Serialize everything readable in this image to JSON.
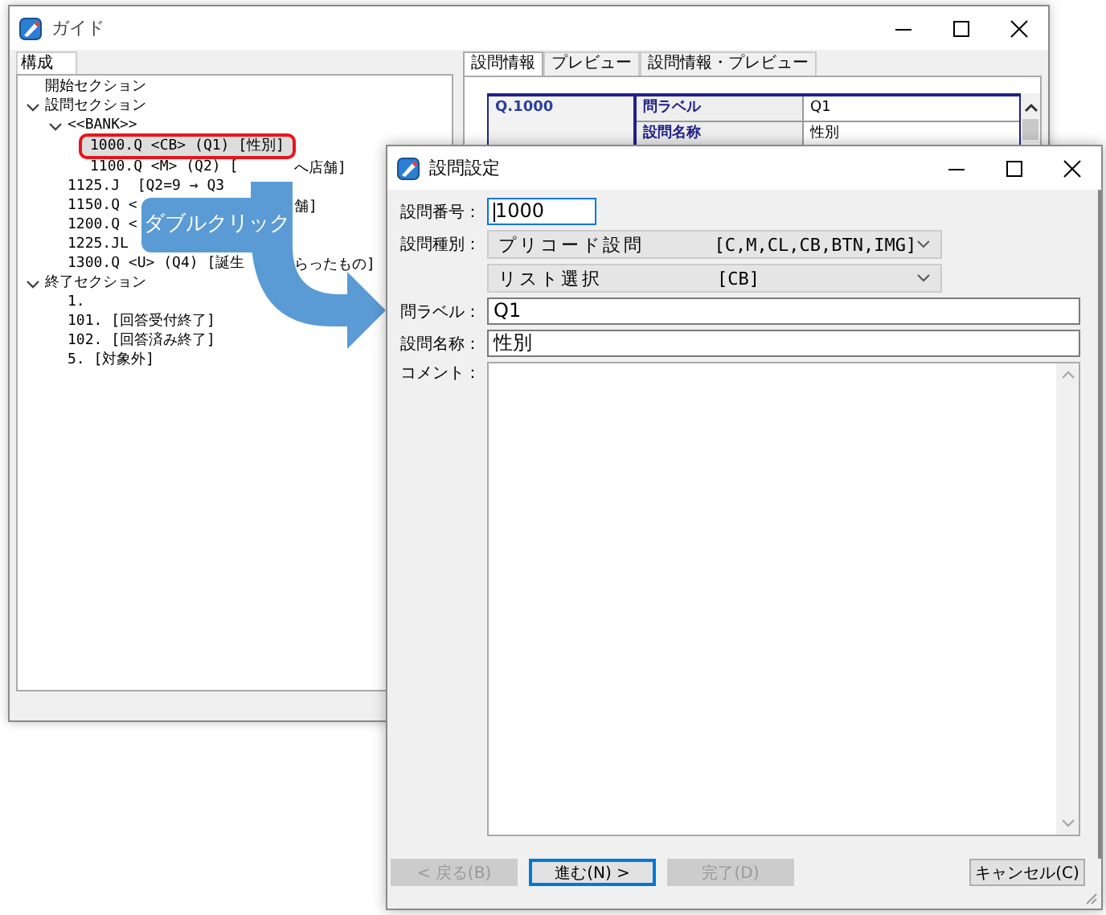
{
  "main_window": {
    "title": "ガイド",
    "left_tab": "構成",
    "tree": [
      {
        "label": "開始セクション",
        "selected": false
      },
      {
        "label": "設問セクション",
        "expanded": true,
        "selected": false,
        "children": [
          {
            "label": "<<BANK>>",
            "expanded": true,
            "selected": false,
            "children": [
              {
                "label": "1000.Q <CB> (Q1) [性別]",
                "selected": true
              },
              {
                "label": "1100.Q <M> (Q2) [",
                "tail": "へ店舗]",
                "selected": false
              }
            ]
          },
          {
            "label": "1125.J  [Q2=9 → Q3",
            "selected": false
          },
          {
            "label": "1150.Q <",
            "tail": "舗]",
            "selected": false
          },
          {
            "label": "1200.Q <",
            "selected": false
          },
          {
            "label": "1225.JL",
            "selected": false
          },
          {
            "label": "1300.Q <U> (Q4) [誕生",
            "tail": "らったもの]",
            "selected": false
          }
        ]
      },
      {
        "label": "終了セクション",
        "expanded": true,
        "selected": false,
        "children": [
          {
            "label": "1.",
            "selected": false
          },
          {
            "label": "101. [回答受付終了]",
            "selected": false
          },
          {
            "label": "102. [回答済み終了]",
            "selected": false
          },
          {
            "label": "5. [対象外]",
            "selected": false
          }
        ]
      }
    ],
    "tabs": [
      {
        "label": "設問情報",
        "selected": true
      },
      {
        "label": "プレビュー",
        "selected": false
      },
      {
        "label": "設問情報・プレビュー",
        "selected": false
      }
    ],
    "info_table": {
      "question": "Q.1000",
      "rows": [
        {
          "label": "問ラベル",
          "value": "Q1"
        },
        {
          "label": "設問名称",
          "value": "性別"
        }
      ]
    }
  },
  "callout": {
    "text": "ダブルクリック"
  },
  "dialog": {
    "title": "設問設定",
    "fields": [
      {
        "kind": "input",
        "label": "設問番号：",
        "value": "1000",
        "focused": true
      },
      {
        "kind": "select",
        "label": "設問種別：",
        "value": "プリコード設問",
        "code": "[C,M,CL,CB,BTN,IMG]"
      },
      {
        "kind": "select",
        "value": "リスト選択",
        "code": "[CB]"
      },
      {
        "kind": "input",
        "label": "問ラベル：",
        "value": "Q1",
        "focused": false
      },
      {
        "kind": "input",
        "label": "設問名称：",
        "value": "性別",
        "focused": false
      },
      {
        "kind": "textarea",
        "label": "コメント："
      }
    ],
    "buttons": [
      {
        "label": "< 戻る(B)",
        "disabled": true,
        "focused": false
      },
      {
        "label": "進む(N) >",
        "disabled": false,
        "focused": true
      },
      {
        "label": "完了(D)",
        "disabled": true,
        "focused": false
      },
      {
        "label": "キャンセル(C)",
        "disabled": false,
        "focused": false
      }
    ]
  }
}
